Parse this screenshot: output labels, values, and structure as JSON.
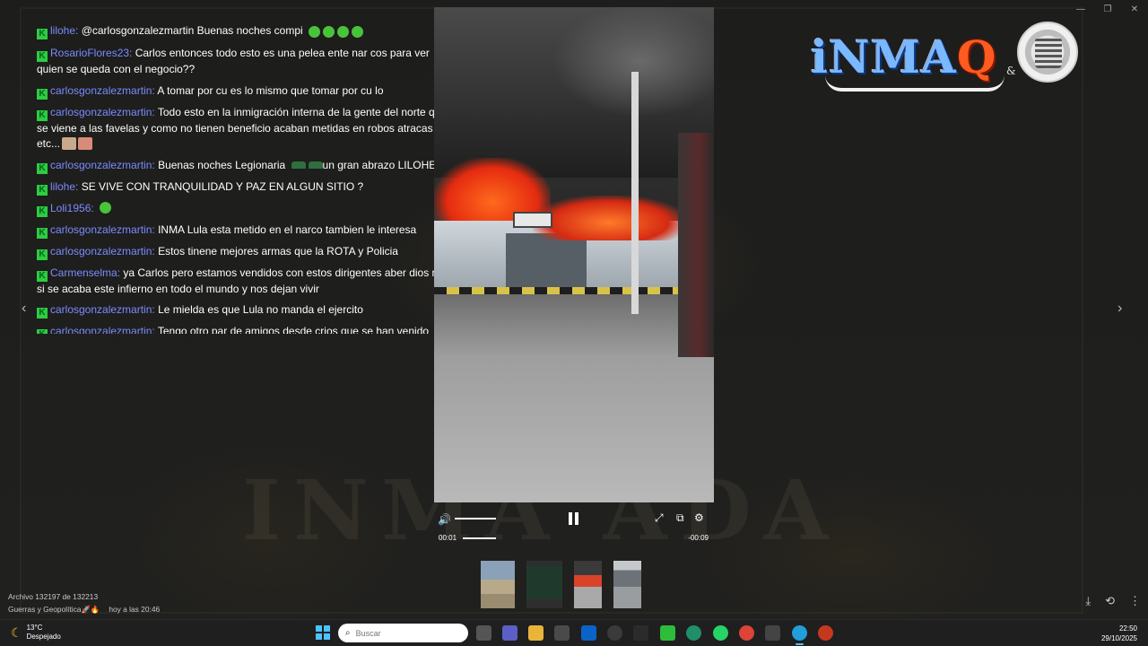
{
  "window": {
    "minimize": "—",
    "maximize": "❐",
    "close": "✕"
  },
  "chat": {
    "messages": [
      {
        "user": "lilohe",
        "text": "@carlosgonzalezmartin Buenas noches compi",
        "emojis": "green-faces"
      },
      {
        "user": "RosarioFlores23",
        "text": "Carlos entonces todo esto es una pelea ente nar cos para ver quien se queda con el negocio??"
      },
      {
        "user": "carlosgonzalezmartin",
        "text": "A tomar por cu es lo mismo que tomar por cu lo"
      },
      {
        "user": "carlosgonzalezmartin",
        "text": "Todo esto en la inmigración interna de la gente del norte que se viene a las favelas y como no tienen beneficio acaban metidas en robos atracas y etc..."
      },
      {
        "user": "carlosgonzalezmartin",
        "text": "Buenas noches Legionaria",
        "text2": "un gran abrazo LILOHE"
      },
      {
        "user": "lilohe",
        "text": "SE VIVE CON TRANQUILIDAD Y PAZ EN ALGUN SITIO ?"
      },
      {
        "user": "Loli1956",
        "text": ""
      },
      {
        "user": "carlosgonzalezmartin",
        "text": "INMA Lula esta metido en el narco tambien le interesa"
      },
      {
        "user": "carlosgonzalezmartin",
        "text": "Estos tinene mejores armas que la ROTA y Policia"
      },
      {
        "user": "Carmenselma",
        "text": "ya Carlos pero estamos vendidos con estos dirigentes aber dios mio si se acaba este infierno en todo el mundo y nos dejan vivir"
      },
      {
        "user": "carlosgonzalezmartin",
        "text": "Le mielda es que Lula no manda el ejercito"
      },
      {
        "user": "carlosgonzalezmartin",
        "text": "Tengo otro par de amigos desde crios que se han venido"
      }
    ]
  },
  "logo": {
    "text_main": "iNMA",
    "text_q": "Q",
    "amp": "&"
  },
  "watermark": "INMA ADA",
  "video": {
    "time_current": "00:01",
    "time_remaining": "-00:09",
    "volume_level": 0.9,
    "progress": 0.1
  },
  "nav": {
    "prev": "‹",
    "next": "›"
  },
  "file_info": {
    "counter": "Archivo 132197 de 132213",
    "channel": "Guerras y Geopolítica🚀🔥",
    "date": "hoy a las 20:46"
  },
  "taskbar": {
    "weather_temp": "13°C",
    "weather_desc": "Despejado",
    "search_placeholder": "Buscar",
    "time": "22:50",
    "date": "29/10/2025"
  }
}
